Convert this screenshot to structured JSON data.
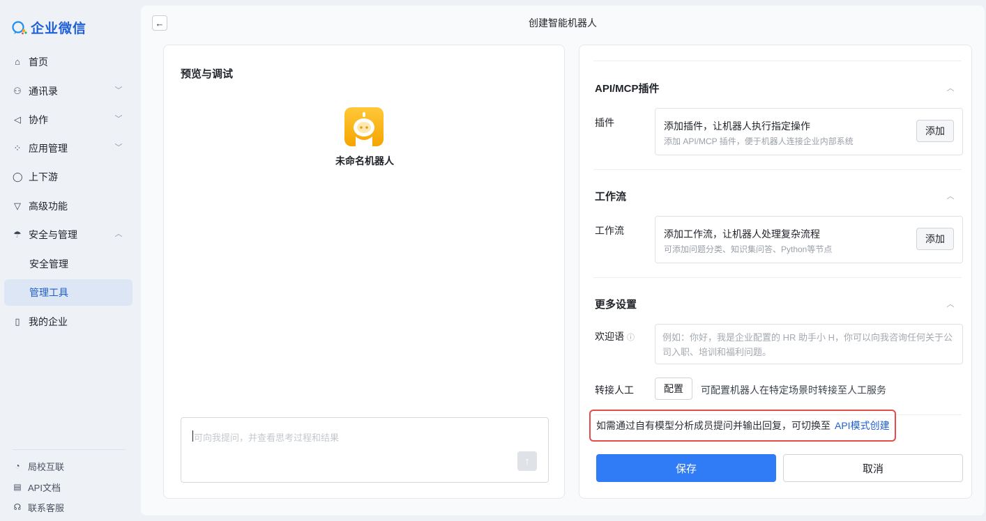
{
  "app": {
    "logo_text": "企业微信"
  },
  "sidebar": {
    "items": [
      {
        "label": "首页",
        "icon": "home-icon"
      },
      {
        "label": "通讯录",
        "icon": "contacts-icon"
      },
      {
        "label": "协作",
        "icon": "collab-icon"
      },
      {
        "label": "应用管理",
        "icon": "apps-icon"
      },
      {
        "label": "上下游",
        "icon": "chat-bubble-icon"
      },
      {
        "label": "高级功能",
        "icon": "triangle-icon"
      },
      {
        "label": "安全与管理",
        "icon": "umbrella-icon"
      },
      {
        "label": "安全管理"
      },
      {
        "label": "管理工具"
      },
      {
        "label": "我的企业",
        "icon": "building-icon"
      }
    ],
    "footer": [
      {
        "label": "局校互联"
      },
      {
        "label": "API文档"
      },
      {
        "label": "联系客服"
      }
    ]
  },
  "header": {
    "title": "创建智能机器人"
  },
  "preview": {
    "title": "预览与调试",
    "bot_name": "未命名机器人",
    "input_placeholder": "可向我提问，并查看思考过程和结果"
  },
  "settings": {
    "plugins": {
      "section_title": "API/MCP插件",
      "label": "插件",
      "box_title": "添加插件，让机器人执行指定操作",
      "box_sub": "添加 API/MCP 插件，便于机器人连接企业内部系统",
      "add_label": "添加"
    },
    "workflow": {
      "section_title": "工作流",
      "label": "工作流",
      "box_title": "添加工作流，让机器人处理复杂流程",
      "box_sub": "可添加问题分类、知识集问答、Python等节点",
      "add_label": "添加"
    },
    "more": {
      "section_title": "更多设置",
      "welcome_label": "欢迎语",
      "welcome_placeholder": "例如：你好，我是企业配置的 HR 助手小 H，你可以向我咨询任何关于公司入职、培训和福利问题。",
      "transfer_label": "转接人工",
      "config_label": "配置",
      "config_desc": "可配置机器人在特定场景时转接至人工服务"
    },
    "notice_text": "如需通过自有模型分析成员提问并输出回复，可切换至",
    "notice_link": "API模式创建",
    "save_label": "保存",
    "cancel_label": "取消"
  },
  "colors": {
    "brand": "#1d5fd8",
    "primary_button": "#2f7cf6",
    "active_nav_bg": "#dde6f5",
    "notice_border": "#e84a4a"
  }
}
